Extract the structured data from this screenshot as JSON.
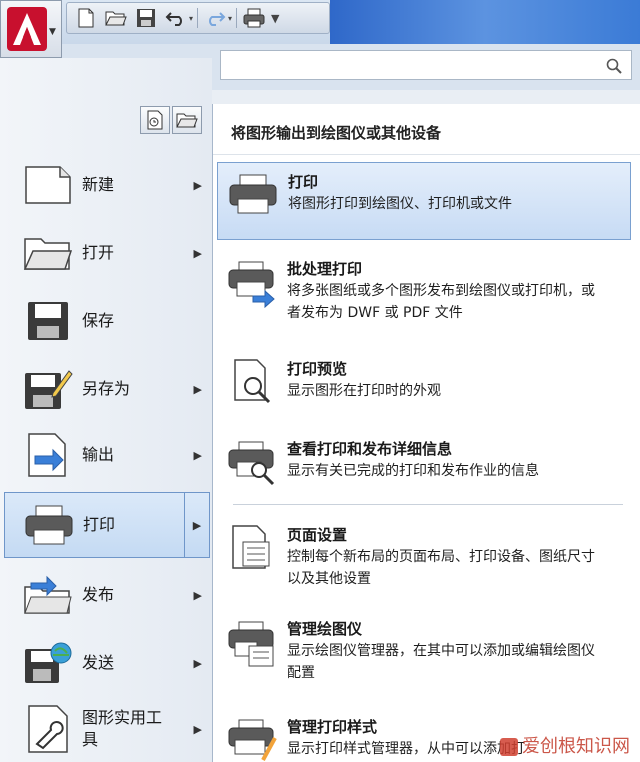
{
  "search": {
    "value": "",
    "placeholder": ""
  },
  "left_menu": {
    "items": [
      {
        "label": "新建",
        "icon": "new-file-icon"
      },
      {
        "label": "打开",
        "icon": "open-folder-icon"
      },
      {
        "label": "保存",
        "icon": "save-disk-icon"
      },
      {
        "label": "另存为",
        "icon": "save-as-icon"
      },
      {
        "label": "输出",
        "icon": "export-icon"
      },
      {
        "label": "打印",
        "icon": "printer-icon"
      },
      {
        "label": "发布",
        "icon": "publish-icon"
      },
      {
        "label": "发送",
        "icon": "send-icon"
      },
      {
        "label": "图形实用工具",
        "icon": "drawing-utilities-icon"
      }
    ]
  },
  "submenu": {
    "header": "将图形输出到绘图仪或其他设备",
    "entries": [
      {
        "title": "打印",
        "desc": "将图形打印到绘图仪、打印机或文件"
      },
      {
        "title": "批处理打印",
        "desc": "将多张图纸或多个图形发布到绘图仪或打印机，或者发布为 DWF 或 PDF 文件"
      },
      {
        "title": "打印预览",
        "desc": "显示图形在打印时的外观"
      },
      {
        "title": "查看打印和发布详细信息",
        "desc": "显示有关已完成的打印和发布作业的信息"
      },
      {
        "title": "页面设置",
        "desc": "控制每个新布局的页面布局、打印设备、图纸尺寸以及其他设置"
      },
      {
        "title": "管理绘图仪",
        "desc": "显示绘图仪管理器，在其中可以添加或编辑绘图仪配置"
      },
      {
        "title": "管理打印样式",
        "desc": "显示打印样式管理器，从中可以添加打"
      }
    ]
  },
  "watermark": "爱创根知识网",
  "colors": {
    "accent": "#6f96c9",
    "brand": "#c8102e",
    "toolbar_blue": "#3b7bd6"
  }
}
